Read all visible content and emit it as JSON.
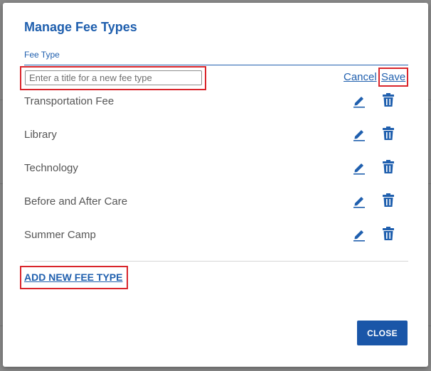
{
  "modal": {
    "title": "Manage Fee Types",
    "column_header": "Fee Type",
    "new_fee_input": {
      "value": "",
      "placeholder": "Enter a title for a new fee type"
    },
    "cancel_label": "Cancel",
    "save_label": "Save",
    "fee_types": [
      {
        "label": "Transportation Fee"
      },
      {
        "label": "Library"
      },
      {
        "label": "Technology"
      },
      {
        "label": "Before and After Care"
      },
      {
        "label": "Summer Camp"
      }
    ],
    "row_icons": {
      "edit": "pencil-icon",
      "delete": "trash-icon"
    },
    "add_new_label": "ADD NEW FEE TYPE",
    "close_label": "CLOSE"
  },
  "colors": {
    "accent": "#1f5fae",
    "primary_button": "#1a56a8",
    "highlight": "#d9252b",
    "text_muted": "#555555"
  }
}
